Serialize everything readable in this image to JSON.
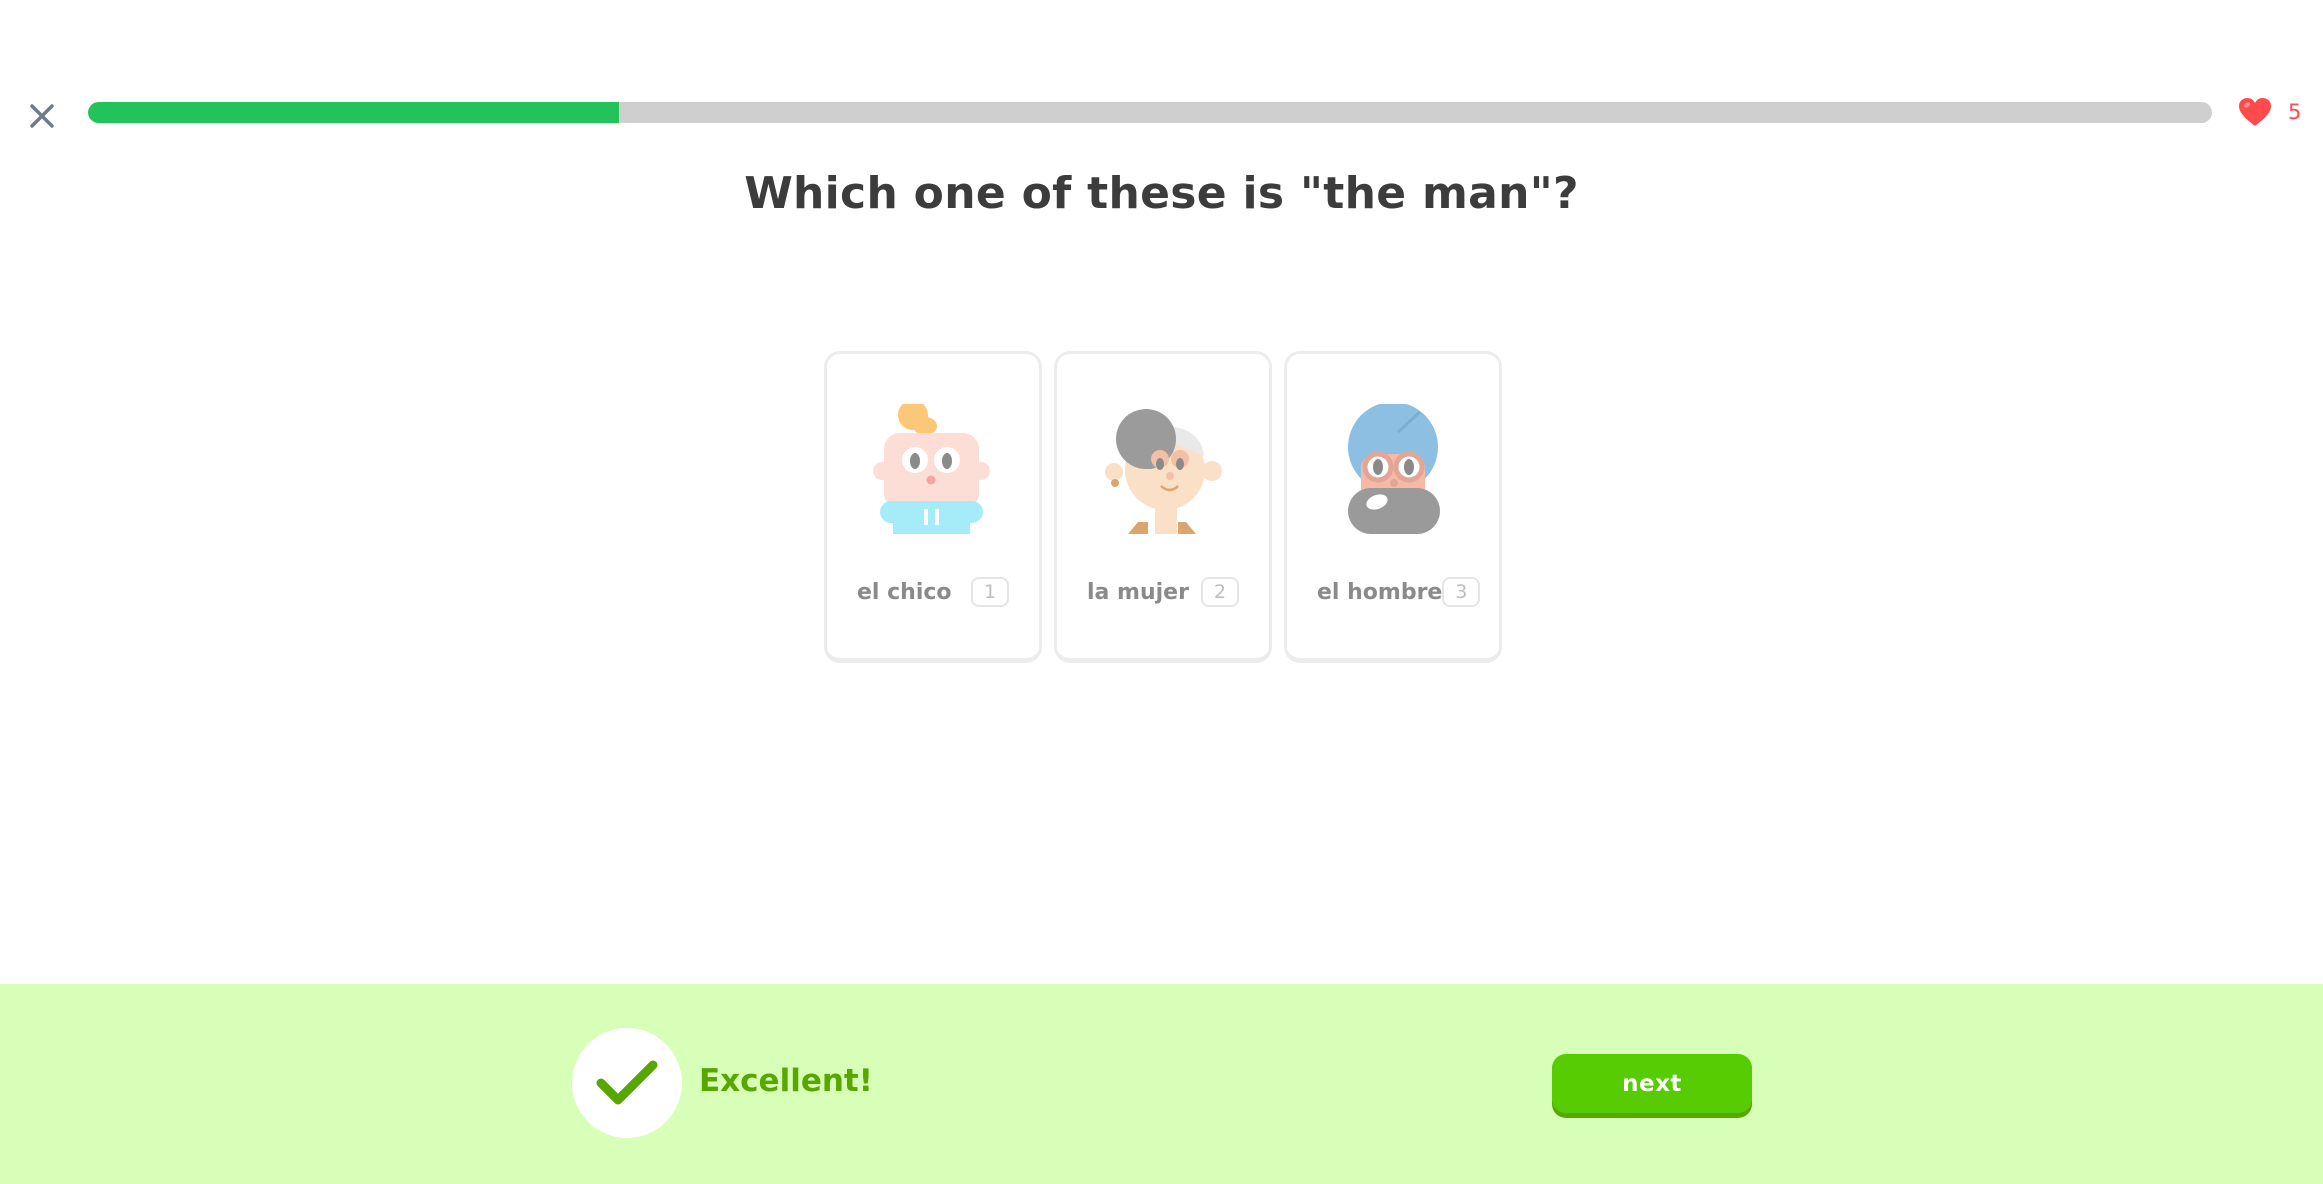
{
  "progress": {
    "fraction": 0.25
  },
  "hearts": {
    "count": "5"
  },
  "question": {
    "text": "Which one of these is \"the man\"?"
  },
  "choices": [
    {
      "label": "el chico",
      "key": "1",
      "icon": "boy-character-icon"
    },
    {
      "label": "la mujer",
      "key": "2",
      "icon": "woman-character-icon"
    },
    {
      "label": "el hombre",
      "key": "3",
      "icon": "man-character-icon"
    }
  ],
  "feedback": {
    "text": "Excellent!",
    "next_label": "next"
  },
  "colors": {
    "progress_fill": "#22c35b",
    "heart": "#ff4b4b",
    "feedback_bg": "#d7ffb8",
    "feedback_text": "#58a700",
    "next_button": "#58cc02"
  }
}
